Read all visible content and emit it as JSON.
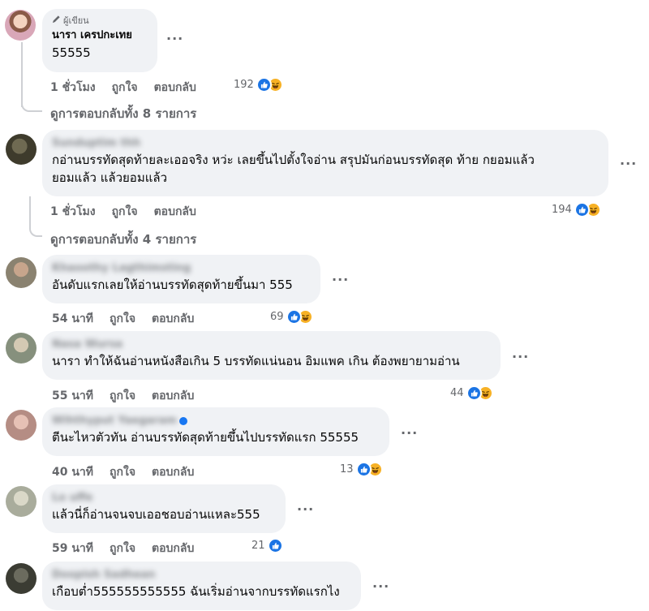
{
  "colors": {
    "bubble": "#f0f2f5",
    "meta": "#65676b",
    "like": "#1b74e4",
    "haha": "#f7b125",
    "thread": "#ced0d4"
  },
  "reply_author": {
    "badge_icon": "pencil-icon",
    "badge": "ผู้เขียน",
    "name": "นารา เครปกะเทย",
    "text": "55555",
    "time": "1 ชั่วโมง",
    "like": "ถูกใจ",
    "reply": "ตอบกลับ",
    "reaction_count": "192",
    "more": "···"
  },
  "view_replies_1": "ดูการตอบกลับทั้ง 8 รายการ",
  "view_replies_2": "ดูการตอบกลับทั้ง 4 รายการ",
  "comments": [
    {
      "author": "Sunduptim thh",
      "lines": [
        "กอ่านบรรทัดสุดท้ายละเออจริง หว่ะ เลยขึ้นไปตั้งใจอ่าน สรุปมันก่อนบรรทัดสุด ท้าย กยอมแล้ว",
        "ยอมแล้ว แล้วยอมแล้ว"
      ],
      "time": "1 ชั่วโมง",
      "like": "ถูกใจ",
      "reply": "ตอบกลับ",
      "reaction_count": "194",
      "more": "···"
    },
    {
      "author": "Khaoothy Lagthimsting",
      "lines": [
        "อันดับแรกเลยให้อ่านบรรทัดสุดท้ายขึ้นมา 555"
      ],
      "time": "54 นาที",
      "like": "ถูกใจ",
      "reply": "ตอบกลับ",
      "reaction_count": "69",
      "more": "···"
    },
    {
      "author": "Nasa Wursa",
      "lines": [
        "นารา ทำให้ฉันอ่านหนังสือเกิน 5 บรรทัดแน่นอน อิมแพค เกิน ต้องพยายามอ่าน"
      ],
      "time": "55 นาที",
      "like": "ถูกใจ",
      "reply": "ตอบกลับ",
      "reaction_count": "44",
      "more": "···"
    },
    {
      "author": "Wihthyput Yaegaram",
      "lines": [
        "ตีนะไหวตัวทัน อ่านบรรทัดสุดท้ายขึ้นไปบรรทัดแรก 55555"
      ],
      "time": "40 นาที",
      "like": "ถูกใจ",
      "reply": "ตอบกลับ",
      "reaction_count": "13",
      "more": "···"
    },
    {
      "author": "Lo uffe",
      "lines": [
        "แล้วนี่ก็อ่านจนจบเออชอบอ่านแหละ555"
      ],
      "time": "59 นาที",
      "like": "ถูกใจ",
      "reply": "ตอบกลับ",
      "reaction_count": "21",
      "more": "···"
    },
    {
      "author": "Doopish Sadhean",
      "lines": [
        "เกือบต่ำ555555555555 ฉันเริ่มอ่านจากบรรทัดแรกไง"
      ],
      "more": "···"
    }
  ]
}
